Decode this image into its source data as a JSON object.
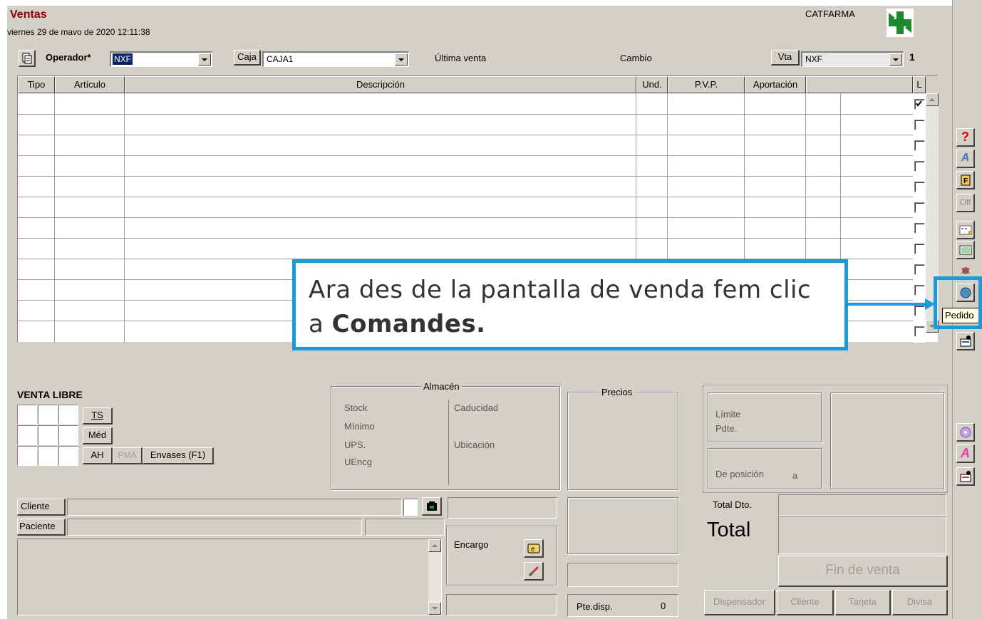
{
  "window": {
    "title": "Ventas",
    "datetime": "viernes 29 de mavo de 2020 12:11:38",
    "brand": "CATFARMA",
    "accent": "#8b0000"
  },
  "toolbar": {
    "operator_label": "Operador*",
    "operator_value": "NXF",
    "caja_label": "Caja",
    "caja_value": "CAJA1",
    "ultima_venta_label": "Última venta",
    "cambio_label": "Cambio",
    "vta_label": "Vta",
    "vta_value": "NXF",
    "vta_count": "1"
  },
  "grid": {
    "columns": [
      "Tipo",
      "Artículo",
      "Descripción",
      "Und.",
      "P.V.P.",
      "Aportación",
      "",
      "L"
    ],
    "rows": 12,
    "first_row_checked": true
  },
  "venta_libre": {
    "title": "VENTA LIBRE",
    "ts_label": "TS",
    "med_label": "Méd",
    "ah_label": "AH",
    "pma_label": "PMA",
    "envases_label": "Envases (F1)"
  },
  "almacen": {
    "legend": "Almacén",
    "stock": "Stock",
    "minimo": "Mínimo",
    "ups": "UPS.",
    "uencg": "UEncg",
    "caducidad": "Caducidad",
    "ubicacion": "Ubicación"
  },
  "precios": {
    "legend": "Precios"
  },
  "limite": {
    "limite": "Límite",
    "pdte": "Pdte.",
    "de_posicion": "De posición",
    "a": "a"
  },
  "cliente": {
    "cliente_label": "Cliente",
    "paciente_label": "Paciente"
  },
  "encargo": {
    "label": "Encargo"
  },
  "pte_disp": {
    "label": "Pte.disp.",
    "value": "0"
  },
  "totals": {
    "total_dto_label": "Total Dto.",
    "total_label": "Total",
    "fin_venta_label": "Fin de venta",
    "dispensador_label": "Dispensador",
    "cliente_label": "Cliente",
    "tarjeta_label": "Tarjeta",
    "divisa_label": "Divisa"
  },
  "side_buttons": {
    "tooltip": "Pedido",
    "off_label": "Off",
    "a_label": "A"
  },
  "callout": {
    "text_prefix": "Ara des de la pantalla de venda fem clic a ",
    "text_bold": "Comandes.",
    "color": "#1a9bd7"
  }
}
